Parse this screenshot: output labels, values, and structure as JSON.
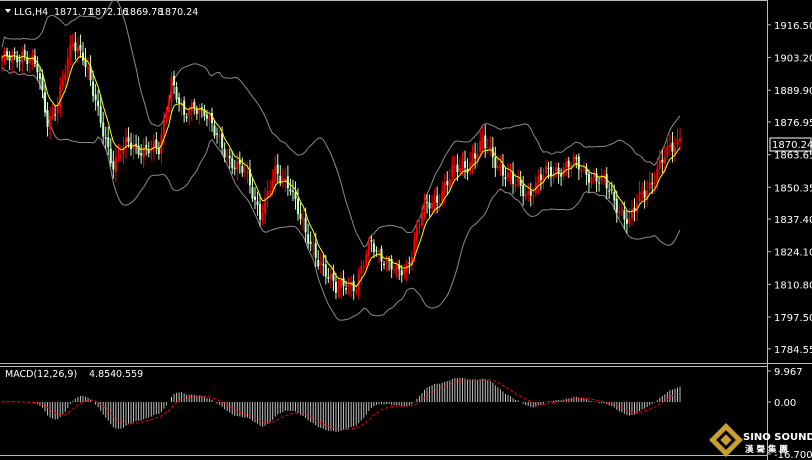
{
  "chart_data": [
    {
      "type": "candlestick",
      "symbol": "LLG,H4",
      "ohlc_readout": [
        "1871.71",
        "1872.16",
        "1869.78",
        "1870.24"
      ],
      "price_label": "1870.24",
      "ylim": [
        1780.0,
        1925.0
      ],
      "yticks": [
        "1916.50",
        "1903.20",
        "1889.90",
        "1876.95",
        "1863.65",
        "1850.35",
        "1837.40",
        "1824.10",
        "1810.80",
        "1797.50",
        "1784.55"
      ],
      "ytick_values": [
        1916.5,
        1903.2,
        1889.9,
        1876.95,
        1863.65,
        1850.35,
        1837.4,
        1824.1,
        1810.8,
        1797.5,
        1784.55
      ],
      "grid": false,
      "colors": {
        "up": "#ff0000",
        "down": "#ccffcc",
        "ma": "#ffff00",
        "bands": "#8a8a8a",
        "background": "#000000"
      },
      "anchors": [
        [
          0,
          1902
        ],
        [
          8,
          1905
        ],
        [
          14,
          1898
        ],
        [
          18,
          1878
        ],
        [
          22,
          1884
        ],
        [
          28,
          1910
        ],
        [
          32,
          1905
        ],
        [
          38,
          1880
        ],
        [
          44,
          1860
        ],
        [
          50,
          1868
        ],
        [
          56,
          1866
        ],
        [
          62,
          1865
        ],
        [
          67,
          1895
        ],
        [
          72,
          1878
        ],
        [
          76,
          1884
        ],
        [
          80,
          1882
        ],
        [
          84,
          1872
        ],
        [
          90,
          1862
        ],
        [
          96,
          1856
        ],
        [
          102,
          1840
        ],
        [
          108,
          1855
        ],
        [
          114,
          1852
        ],
        [
          120,
          1830
        ],
        [
          126,
          1820
        ],
        [
          132,
          1808
        ],
        [
          136,
          1812
        ],
        [
          140,
          1810
        ],
        [
          146,
          1828
        ],
        [
          152,
          1820
        ],
        [
          156,
          1815
        ],
        [
          160,
          1818
        ],
        [
          166,
          1840
        ],
        [
          172,
          1846
        ],
        [
          178,
          1856
        ],
        [
          184,
          1860
        ],
        [
          190,
          1868
        ],
        [
          196,
          1860
        ],
        [
          202,
          1852
        ],
        [
          208,
          1848
        ],
        [
          214,
          1855
        ],
        [
          220,
          1858
        ],
        [
          226,
          1860
        ],
        [
          232,
          1856
        ],
        [
          238,
          1852
        ],
        [
          244,
          1842
        ],
        [
          248,
          1836
        ],
        [
          252,
          1846
        ],
        [
          258,
          1855
        ],
        [
          264,
          1866
        ],
        [
          268,
          1870.24
        ]
      ],
      "candle_count": 269
    },
    {
      "type": "macd-histogram",
      "title": "MACD(12,26,9)",
      "readout": [
        "4.854",
        "0.559"
      ],
      "yticks": [
        "9.967",
        "0.00",
        "-16.700"
      ],
      "ytick_values": [
        9.967,
        0.0,
        -16.7
      ],
      "ylim": [
        -16.7,
        9.967
      ],
      "colors": {
        "histogram": "#c0c0c0",
        "signal": "#ff0000"
      }
    }
  ],
  "branding": {
    "logo_text": "SINO SOUND",
    "logo_sub": "漢 聲 集 團"
  }
}
